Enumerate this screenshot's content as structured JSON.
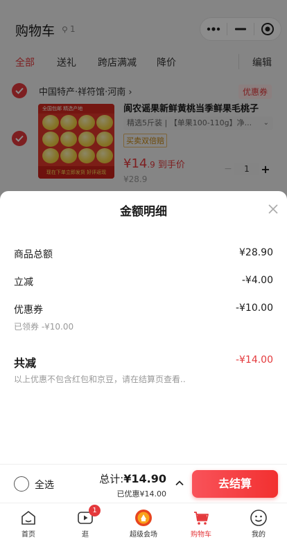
{
  "header": {
    "title": "购物车",
    "location_count": "1"
  },
  "tabs": [
    {
      "label": "全部"
    },
    {
      "label": "送礼"
    },
    {
      "label": "跨店满减"
    },
    {
      "label": "降价"
    }
  ],
  "edit_label": "编辑",
  "store": {
    "name": "中国特产·祥符馆·河南 ›",
    "coupon_label": "优惠券"
  },
  "item": {
    "title": "阆农谣果新鲜黄桃当季鲜果毛桃子",
    "spec": "精选5斤装 | 【单果100-110g】净...",
    "badge": "买卖双倍赔",
    "price_int": "¥14",
    "price_dec": ".9",
    "price_tag": "到手价",
    "original_price": "¥28.9",
    "quantity": "1",
    "image_top_text": "全国包邮 精选产地",
    "image_bottom_text": "现在下单立即发货 好评返现"
  },
  "sheet": {
    "title": "金额明细",
    "rows": [
      {
        "label": "商品总额",
        "value": "¥28.90"
      },
      {
        "label": "立减",
        "value": "-¥4.00"
      },
      {
        "label": "优惠券",
        "value": "-¥10.00",
        "sub": "已领券 -¥10.00"
      }
    ],
    "total_label": "共减",
    "total_value": "-¥14.00",
    "note": "以上优惠不包含红包和京豆，请在结算页查看.."
  },
  "checkout": {
    "select_all": "全选",
    "sum_label": "总计:",
    "sum_value": "¥14.90",
    "discount_text": "已优惠¥14.00",
    "button": "去结算"
  },
  "tabbar": [
    {
      "label": "首页",
      "icon": "home-icon"
    },
    {
      "label": "逛",
      "icon": "video-icon",
      "badge": "1"
    },
    {
      "label": "超级会场",
      "icon": "venue-icon"
    },
    {
      "label": "购物车",
      "icon": "cart-icon"
    },
    {
      "label": "我的",
      "icon": "profile-icon"
    }
  ],
  "colors": {
    "accent": "#e4393c",
    "overlay": "rgba(0,0,0,0.45)"
  }
}
